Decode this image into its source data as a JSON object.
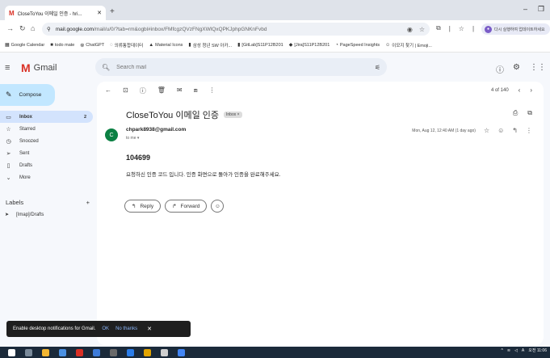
{
  "browser": {
    "tab_title": "CloseToYou 이메일 인증 - hri...",
    "url_host": "mail.google.com",
    "url_path": "/mail/u/0/?tab=rm&ogbl#inbox/FMfcgzQVzFNgXWlQxQPKJphpGNKnFvbd",
    "profile_text": "다시 실행하여 업데이트하세요"
  },
  "bookmarks": [
    {
      "label": "Google Calendar",
      "icon": "calendar-icon"
    },
    {
      "label": "todo mate",
      "icon": "todo-icon"
    },
    {
      "label": "ChatGPT",
      "icon": "chatgpt-icon"
    },
    {
      "label": "의류통합데이터",
      "icon": "link-icon"
    },
    {
      "label": "Material Icons",
      "icon": "material-icon"
    },
    {
      "label": "삼성 청년 SW 아카...",
      "icon": "folder-icon"
    },
    {
      "label": "[GitLab]S11P12B201",
      "icon": "folder-icon"
    },
    {
      "label": "[Jira]S11P12B201",
      "icon": "jira-icon"
    },
    {
      "label": "PageSpeed Insights",
      "icon": "pagespeed-icon"
    },
    {
      "label": "이모지 찾기 | Emoji...",
      "icon": "emoji-icon"
    }
  ],
  "gmail": {
    "logo_text": "Gmail",
    "search_placeholder": "Search mail",
    "compose_label": "Compose"
  },
  "sidebar": {
    "items": [
      {
        "label": "Inbox",
        "count": "2",
        "icon": "inbox-icon",
        "active": true
      },
      {
        "label": "Starred",
        "count": "",
        "icon": "star-icon"
      },
      {
        "label": "Snoozed",
        "count": "",
        "icon": "clock-icon"
      },
      {
        "label": "Sent",
        "count": "",
        "icon": "send-icon"
      },
      {
        "label": "Drafts",
        "count": "",
        "icon": "draft-icon"
      },
      {
        "label": "More",
        "count": "",
        "icon": "chevron-down-icon"
      }
    ],
    "labels_title": "Labels",
    "labels_add": "+",
    "label_items": [
      {
        "label": "[Imap]/Drafts",
        "icon": "label-icon"
      }
    ]
  },
  "message": {
    "pager": "4 of 140",
    "subject": "CloseToYou 이메일 인증",
    "badge": "Inbox ×",
    "sender": "chpark8938@gmail.com",
    "to": "to me ▾",
    "date": "Mon, Aug 12, 12:40 AM (1 day ago)",
    "avatar_letter": "C",
    "code": "104699",
    "body": "요청하신 인증 코드 입니다. 인증 화면으로 돌아가 인증을 완료해주세요.",
    "reply_label": "Reply",
    "forward_label": "Forward"
  },
  "snackbar": {
    "text": "Enable desktop notifications for Gmail.",
    "ok": "OK",
    "no": "No thanks"
  },
  "taskbar": {
    "time": "오전 11:06",
    "lang": "A"
  },
  "colors": {
    "accent": "#c2e7ff",
    "active_item": "#d3e3fd",
    "avatar": "#0b8043",
    "gmail_red": "#d93025"
  }
}
